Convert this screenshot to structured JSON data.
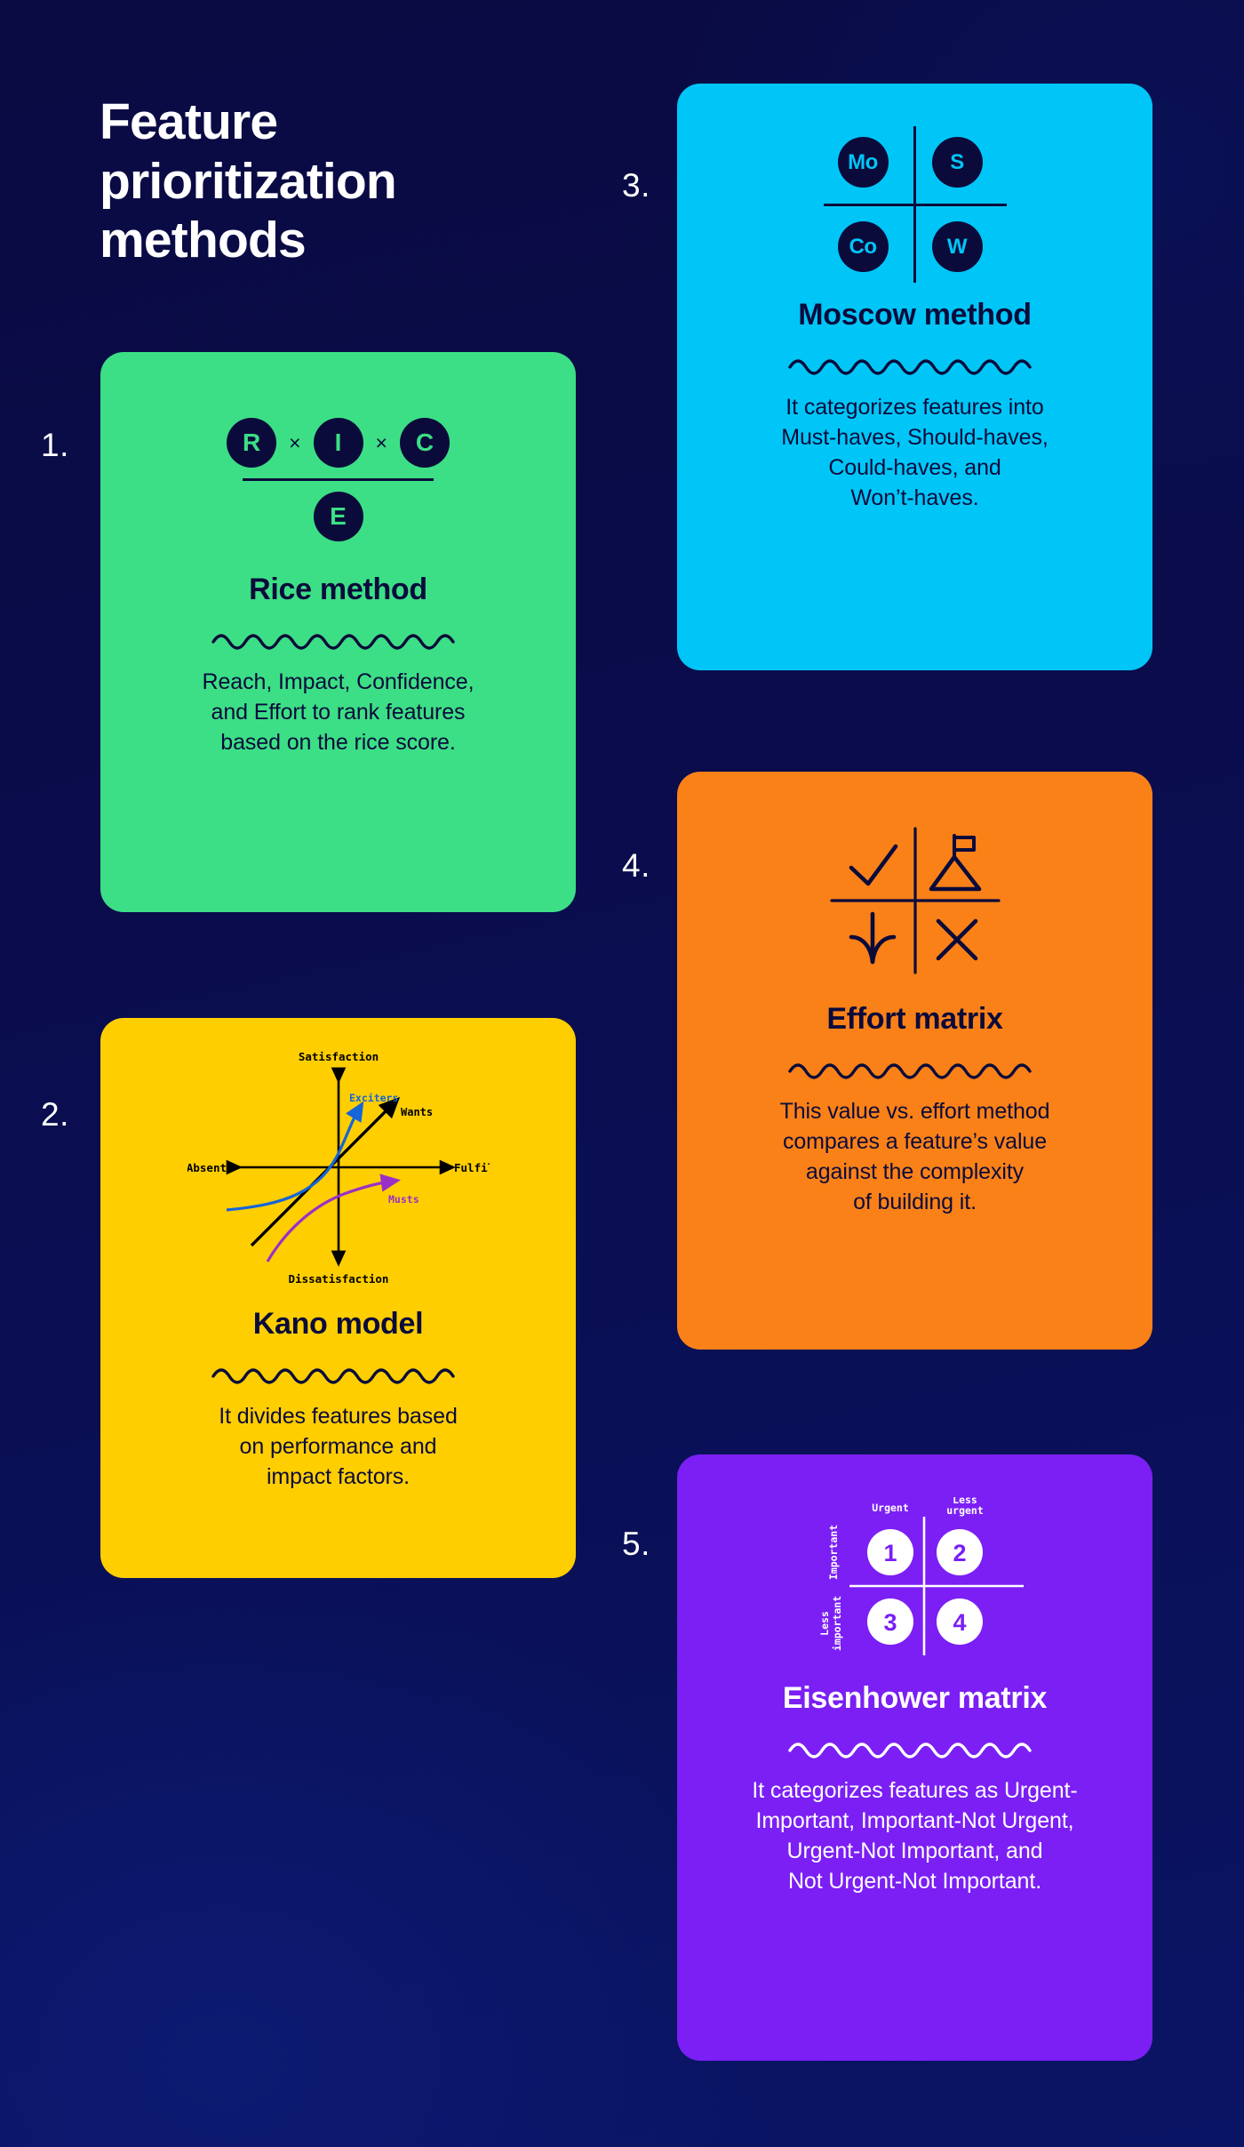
{
  "page": {
    "title": "Feature prioritization methods",
    "background_color": "#0A0C4C"
  },
  "colors": {
    "background": "#0A0C4C",
    "ink_dark": "#0B0B3B",
    "ink_light": "#FFFFFF",
    "green": "#3CDF85",
    "yellow": "#FFCE00",
    "cyan": "#00C6F7",
    "orange": "#FA8118",
    "purple": "#7B1FF5"
  },
  "cards": [
    {
      "number": "1.",
      "title": "Rice method",
      "description": "Reach, Impact, Confidence,\nand Effort to rank features\nbased on the rice score.",
      "accent": "#3CDF85",
      "visual": {
        "type": "rice-formula",
        "numerator": [
          "R",
          "I",
          "C"
        ],
        "operator": "×",
        "denominator": "E"
      }
    },
    {
      "number": "2.",
      "title": "Kano model",
      "description": "It divides features based\non performance and\nimpact factors.",
      "accent": "#FFCE00",
      "visual": {
        "type": "kano-chart",
        "axis_top": "Satisfaction",
        "axis_bottom": "Dissatisfaction",
        "axis_left": "Absent",
        "axis_right": "Fulfilled",
        "curves": [
          {
            "label": "Exciters",
            "color": "#1565D8"
          },
          {
            "label": "Wants",
            "color": "#000000"
          },
          {
            "label": "Musts",
            "color": "#9B30C8"
          }
        ]
      }
    },
    {
      "number": "3.",
      "title": "Moscow method",
      "description": "It categorizes features into\nMust-haves, Should-haves,\nCould-haves, and\nWon’t-haves.",
      "accent": "#00C6F7",
      "visual": {
        "type": "moscow-quadrant",
        "quadrants": [
          "Mo",
          "S",
          "Co",
          "W"
        ]
      }
    },
    {
      "number": "4.",
      "title": "Effort matrix",
      "description": "This value vs. effort method\ncompares a feature’s value\nagainst the complexity\nof building it.",
      "accent": "#FA8118",
      "visual": {
        "type": "effort-matrix",
        "quadrant_icons": [
          "check-icon",
          "mountain-flag-icon",
          "down-arrow-icon",
          "cross-icon"
        ]
      }
    },
    {
      "number": "5.",
      "title": "Eisenhower matrix",
      "description": "It categorizes features as Urgent-\nImportant, Important-Not Urgent,\nUrgent-Not Important, and\nNot Urgent-Not Important.",
      "accent": "#7B1FF5",
      "visual": {
        "type": "eisenhower-matrix",
        "col_labels": [
          "Urgent",
          "Less\nurgent"
        ],
        "row_labels": [
          "Important",
          "Less\nimportant"
        ],
        "quadrants": [
          "1",
          "2",
          "3",
          "4"
        ]
      }
    }
  ]
}
